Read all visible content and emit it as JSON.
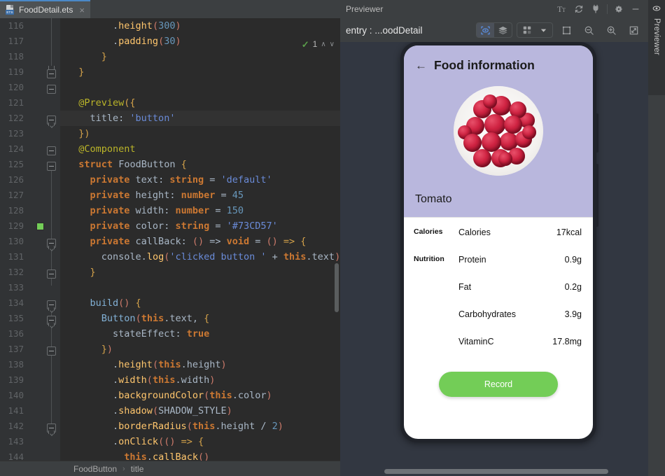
{
  "editor": {
    "tab": {
      "filename": "FoodDetail.ets",
      "icon": "ets-file-icon",
      "badge": "ETS",
      "close": "×"
    },
    "inspection": {
      "check_icon": "inspection-ok-icon",
      "count": "1",
      "prev": "∧",
      "next": "∨"
    },
    "breadcrumbs": {
      "items": [
        "FoodButton",
        "title"
      ],
      "separator": "›"
    },
    "color_swatch_hex": "#73CD57",
    "current_line": 122,
    "first_line": 116,
    "lines": [
      {
        "n": "116",
        "tokens": [
          {
            "t": "        .",
            "c": "plain"
          },
          {
            "t": "height",
            "c": "fn"
          },
          {
            "t": "(",
            "c": "paren"
          },
          {
            "t": "300",
            "c": "num"
          },
          {
            "t": ")",
            "c": "paren"
          }
        ]
      },
      {
        "n": "117",
        "tokens": [
          {
            "t": "        .",
            "c": "plain"
          },
          {
            "t": "padding",
            "c": "fn"
          },
          {
            "t": "(",
            "c": "paren"
          },
          {
            "t": "30",
            "c": "num"
          },
          {
            "t": ")",
            "c": "paren"
          }
        ]
      },
      {
        "n": "118",
        "tokens": [
          {
            "t": "      }",
            "c": "brace"
          }
        ]
      },
      {
        "n": "119",
        "tokens": [
          {
            "t": "  }",
            "c": "brace"
          }
        ]
      },
      {
        "n": "120",
        "tokens": [
          {
            "t": "",
            "c": "plain"
          }
        ]
      },
      {
        "n": "121",
        "tokens": [
          {
            "t": "  ",
            "c": "plain"
          },
          {
            "t": "@Preview",
            "c": "anno"
          },
          {
            "t": "({",
            "c": "brace"
          }
        ]
      },
      {
        "n": "122",
        "tokens": [
          {
            "t": "    title",
            "c": "plain"
          },
          {
            "t": ": ",
            "c": "plain"
          },
          {
            "t": "'button'",
            "c": "str"
          }
        ]
      },
      {
        "n": "123",
        "tokens": [
          {
            "t": "  })",
            "c": "brace"
          }
        ]
      },
      {
        "n": "124",
        "tokens": [
          {
            "t": "  ",
            "c": "plain"
          },
          {
            "t": "@Component",
            "c": "anno"
          }
        ]
      },
      {
        "n": "125",
        "tokens": [
          {
            "t": "  ",
            "c": "plain"
          },
          {
            "t": "struct",
            "c": "kw"
          },
          {
            "t": " ",
            "c": "plain"
          },
          {
            "t": "FoodButton",
            "c": "type"
          },
          {
            "t": " {",
            "c": "brace"
          }
        ]
      },
      {
        "n": "126",
        "tokens": [
          {
            "t": "    ",
            "c": "plain"
          },
          {
            "t": "private",
            "c": "kw"
          },
          {
            "t": " text",
            "c": "plain"
          },
          {
            "t": ": ",
            "c": "plain"
          },
          {
            "t": "string",
            "c": "typ2"
          },
          {
            "t": " = ",
            "c": "plain"
          },
          {
            "t": "'default'",
            "c": "str"
          }
        ]
      },
      {
        "n": "127",
        "tokens": [
          {
            "t": "    ",
            "c": "plain"
          },
          {
            "t": "private",
            "c": "kw"
          },
          {
            "t": " height",
            "c": "plain"
          },
          {
            "t": ": ",
            "c": "plain"
          },
          {
            "t": "number",
            "c": "typ2"
          },
          {
            "t": " = ",
            "c": "plain"
          },
          {
            "t": "45",
            "c": "num"
          }
        ]
      },
      {
        "n": "128",
        "tokens": [
          {
            "t": "    ",
            "c": "plain"
          },
          {
            "t": "private",
            "c": "kw"
          },
          {
            "t": " width",
            "c": "plain"
          },
          {
            "t": ": ",
            "c": "plain"
          },
          {
            "t": "number",
            "c": "typ2"
          },
          {
            "t": " = ",
            "c": "plain"
          },
          {
            "t": "150",
            "c": "num"
          }
        ]
      },
      {
        "n": "129",
        "tokens": [
          {
            "t": "    ",
            "c": "plain"
          },
          {
            "t": "private",
            "c": "kw"
          },
          {
            "t": " color",
            "c": "plain"
          },
          {
            "t": ": ",
            "c": "plain"
          },
          {
            "t": "string",
            "c": "typ2"
          },
          {
            "t": " = ",
            "c": "plain"
          },
          {
            "t": "'#73CD57'",
            "c": "str"
          }
        ]
      },
      {
        "n": "130",
        "tokens": [
          {
            "t": "    ",
            "c": "plain"
          },
          {
            "t": "private",
            "c": "kw"
          },
          {
            "t": " callBack",
            "c": "plain"
          },
          {
            "t": ": ",
            "c": "plain"
          },
          {
            "t": "()",
            "c": "paren"
          },
          {
            "t": " => ",
            "c": "plain"
          },
          {
            "t": "void",
            "c": "kw"
          },
          {
            "t": " = ",
            "c": "plain"
          },
          {
            "t": "()",
            "c": "paren"
          },
          {
            "t": " => {",
            "c": "brace"
          }
        ]
      },
      {
        "n": "131",
        "tokens": [
          {
            "t": "      console",
            "c": "plain"
          },
          {
            "t": ".",
            "c": "plain"
          },
          {
            "t": "log",
            "c": "fn"
          },
          {
            "t": "(",
            "c": "paren"
          },
          {
            "t": "'clicked button '",
            "c": "str"
          },
          {
            "t": " + ",
            "c": "plain"
          },
          {
            "t": "this",
            "c": "kw"
          },
          {
            "t": ".text",
            "c": "plain"
          },
          {
            "t": ")",
            "c": "paren"
          }
        ]
      },
      {
        "n": "132",
        "tokens": [
          {
            "t": "    }",
            "c": "brace"
          }
        ]
      },
      {
        "n": "133",
        "tokens": [
          {
            "t": "",
            "c": "plain"
          }
        ]
      },
      {
        "n": "134",
        "tokens": [
          {
            "t": "    ",
            "c": "plain"
          },
          {
            "t": "build",
            "c": "fn2"
          },
          {
            "t": "()",
            "c": "paren"
          },
          {
            "t": " {",
            "c": "brace"
          }
        ]
      },
      {
        "n": "135",
        "tokens": [
          {
            "t": "      ",
            "c": "plain"
          },
          {
            "t": "Button",
            "c": "fn2"
          },
          {
            "t": "(",
            "c": "paren"
          },
          {
            "t": "this",
            "c": "kw"
          },
          {
            "t": ".text, ",
            "c": "plain"
          },
          {
            "t": "{",
            "c": "brace"
          }
        ]
      },
      {
        "n": "136",
        "tokens": [
          {
            "t": "        stateEffect",
            "c": "plain"
          },
          {
            "t": ": ",
            "c": "plain"
          },
          {
            "t": "true",
            "c": "kw"
          }
        ]
      },
      {
        "n": "137",
        "tokens": [
          {
            "t": "      }",
            "c": "brace"
          },
          {
            "t": ")",
            "c": "paren"
          }
        ]
      },
      {
        "n": "138",
        "tokens": [
          {
            "t": "        .",
            "c": "plain"
          },
          {
            "t": "height",
            "c": "fn"
          },
          {
            "t": "(",
            "c": "paren"
          },
          {
            "t": "this",
            "c": "kw"
          },
          {
            "t": ".height",
            "c": "plain"
          },
          {
            "t": ")",
            "c": "paren"
          }
        ]
      },
      {
        "n": "139",
        "tokens": [
          {
            "t": "        .",
            "c": "plain"
          },
          {
            "t": "width",
            "c": "fn"
          },
          {
            "t": "(",
            "c": "paren"
          },
          {
            "t": "this",
            "c": "kw"
          },
          {
            "t": ".width",
            "c": "plain"
          },
          {
            "t": ")",
            "c": "paren"
          }
        ]
      },
      {
        "n": "140",
        "tokens": [
          {
            "t": "        .",
            "c": "plain"
          },
          {
            "t": "backgroundColor",
            "c": "fn"
          },
          {
            "t": "(",
            "c": "paren"
          },
          {
            "t": "this",
            "c": "kw"
          },
          {
            "t": ".color",
            "c": "plain"
          },
          {
            "t": ")",
            "c": "paren"
          }
        ]
      },
      {
        "n": "141",
        "tokens": [
          {
            "t": "        .",
            "c": "plain"
          },
          {
            "t": "shadow",
            "c": "fn"
          },
          {
            "t": "(",
            "c": "paren"
          },
          {
            "t": "SHADOW_STYLE",
            "c": "plain"
          },
          {
            "t": ")",
            "c": "paren"
          }
        ]
      },
      {
        "n": "142",
        "tokens": [
          {
            "t": "        .",
            "c": "plain"
          },
          {
            "t": "borderRadius",
            "c": "fn"
          },
          {
            "t": "(",
            "c": "paren"
          },
          {
            "t": "this",
            "c": "kw"
          },
          {
            "t": ".height / ",
            "c": "plain"
          },
          {
            "t": "2",
            "c": "num"
          },
          {
            "t": ")",
            "c": "paren"
          }
        ]
      },
      {
        "n": "143",
        "tokens": [
          {
            "t": "        .",
            "c": "plain"
          },
          {
            "t": "onClick",
            "c": "fn"
          },
          {
            "t": "(",
            "c": "paren"
          },
          {
            "t": "()",
            "c": "paren"
          },
          {
            "t": " => {",
            "c": "brace"
          }
        ]
      },
      {
        "n": "144",
        "tokens": [
          {
            "t": "          ",
            "c": "plain"
          },
          {
            "t": "this",
            "c": "kw"
          },
          {
            "t": ".",
            "c": "plain"
          },
          {
            "t": "callBack",
            "c": "fn"
          },
          {
            "t": "()",
            "c": "paren"
          }
        ]
      }
    ]
  },
  "previewer": {
    "title": "Previewer",
    "titlebar_icons": [
      "font-size-icon",
      "refresh-icon",
      "plug-icon",
      "settings-gear-icon",
      "minimize-icon"
    ],
    "entry_label": "entry : ...oodDetail",
    "toolbar_icons": [
      "inspector-eye-icon",
      "layers-icon",
      "multi-device-icon",
      "chevron-down-icon",
      "device-frame-icon",
      "zoom-out-icon",
      "zoom-in-icon",
      "fit-screen-icon"
    ]
  },
  "right_strip": {
    "label": "Previewer",
    "icon": "eye-icon"
  },
  "phone_app": {
    "back_icon": "back-arrow-icon",
    "header_title": "Food information",
    "food_name": "Tomato",
    "food_image": "tomato-bowl-image",
    "nutrition_rows": [
      {
        "category": "Calories",
        "name": "Calories",
        "value": "17kcal"
      },
      {
        "category": "Nutrition",
        "name": "Protein",
        "value": "0.9g"
      },
      {
        "category": "",
        "name": "Fat",
        "value": "0.2g"
      },
      {
        "category": "",
        "name": "Carbohydrates",
        "value": "3.9g"
      },
      {
        "category": "",
        "name": "VitaminC",
        "value": "17.8mg"
      }
    ],
    "record_button": "Record",
    "colors": {
      "hero": "#b9b7dd",
      "record": "#73CD57"
    }
  }
}
